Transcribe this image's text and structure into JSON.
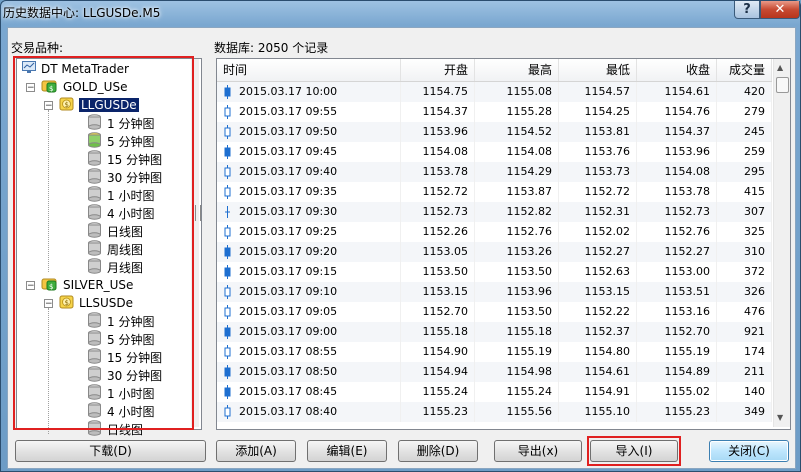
{
  "window": {
    "title": "历史数据中心: LLGUSDe.M5",
    "help_label": "?",
    "close_label": "✕"
  },
  "symbols_label": "交易品种:",
  "database_label": "数据库: 2050 个记录",
  "tree": {
    "root": "DT MetaTrader",
    "groups": [
      {
        "name": "GOLD_USe",
        "symbol": "LLGUSDe",
        "symbol_selected": true,
        "periods": [
          "1 分钟图",
          "5 分钟图",
          "15 分钟图",
          "30 分钟图",
          "1 小时图",
          "4 小时图",
          "日线图",
          "周线图",
          "月线图"
        ],
        "active_period": "5 分钟图"
      },
      {
        "name": "SILVER_USe",
        "symbol": "LLSUSDe",
        "symbol_selected": false,
        "periods": [
          "1 分钟图",
          "5 分钟图",
          "15 分钟图",
          "30 分钟图",
          "1 小时图",
          "4 小时图",
          "日线图"
        ],
        "active_period": ""
      }
    ]
  },
  "table": {
    "columns": [
      "时间",
      "开盘",
      "最高",
      "最低",
      "收盘",
      "成交量"
    ],
    "rows": [
      {
        "time": "2015.03.17 10:00",
        "open": "1154.75",
        "high": "1155.08",
        "low": "1154.57",
        "close": "1154.61",
        "vol": "420",
        "dir": "down"
      },
      {
        "time": "2015.03.17 09:55",
        "open": "1154.37",
        "high": "1155.28",
        "low": "1154.25",
        "close": "1154.76",
        "vol": "279",
        "dir": "up"
      },
      {
        "time": "2015.03.17 09:50",
        "open": "1153.96",
        "high": "1154.52",
        "low": "1153.81",
        "close": "1154.37",
        "vol": "245",
        "dir": "up"
      },
      {
        "time": "2015.03.17 09:45",
        "open": "1154.08",
        "high": "1154.08",
        "low": "1153.76",
        "close": "1153.96",
        "vol": "259",
        "dir": "down"
      },
      {
        "time": "2015.03.17 09:40",
        "open": "1153.78",
        "high": "1154.29",
        "low": "1153.73",
        "close": "1154.08",
        "vol": "295",
        "dir": "up"
      },
      {
        "time": "2015.03.17 09:35",
        "open": "1152.72",
        "high": "1153.87",
        "low": "1152.72",
        "close": "1153.78",
        "vol": "415",
        "dir": "up"
      },
      {
        "time": "2015.03.17 09:30",
        "open": "1152.73",
        "high": "1152.82",
        "low": "1152.31",
        "close": "1152.73",
        "vol": "307",
        "dir": "flat"
      },
      {
        "time": "2015.03.17 09:25",
        "open": "1152.26",
        "high": "1152.76",
        "low": "1152.02",
        "close": "1152.76",
        "vol": "325",
        "dir": "up"
      },
      {
        "time": "2015.03.17 09:20",
        "open": "1153.05",
        "high": "1153.26",
        "low": "1152.27",
        "close": "1152.27",
        "vol": "310",
        "dir": "down"
      },
      {
        "time": "2015.03.17 09:15",
        "open": "1153.50",
        "high": "1153.50",
        "low": "1152.63",
        "close": "1153.00",
        "vol": "372",
        "dir": "down"
      },
      {
        "time": "2015.03.17 09:10",
        "open": "1153.15",
        "high": "1153.96",
        "low": "1153.15",
        "close": "1153.51",
        "vol": "326",
        "dir": "up"
      },
      {
        "time": "2015.03.17 09:05",
        "open": "1152.70",
        "high": "1153.50",
        "low": "1152.22",
        "close": "1153.16",
        "vol": "476",
        "dir": "up"
      },
      {
        "time": "2015.03.17 09:00",
        "open": "1155.18",
        "high": "1155.18",
        "low": "1152.37",
        "close": "1152.70",
        "vol": "921",
        "dir": "down"
      },
      {
        "time": "2015.03.17 08:55",
        "open": "1154.90",
        "high": "1155.19",
        "low": "1154.80",
        "close": "1155.19",
        "vol": "174",
        "dir": "up"
      },
      {
        "time": "2015.03.17 08:50",
        "open": "1154.94",
        "high": "1154.98",
        "low": "1154.61",
        "close": "1154.89",
        "vol": "211",
        "dir": "down"
      },
      {
        "time": "2015.03.17 08:45",
        "open": "1155.24",
        "high": "1155.24",
        "low": "1154.91",
        "close": "1155.02",
        "vol": "140",
        "dir": "down"
      },
      {
        "time": "2015.03.17 08:40",
        "open": "1155.23",
        "high": "1155.56",
        "low": "1155.10",
        "close": "1155.23",
        "vol": "349",
        "dir": "up"
      }
    ]
  },
  "buttons": {
    "download": "下载(D)",
    "add": "添加(A)",
    "edit": "编辑(E)",
    "delete": "删除(D)",
    "export": "导出(x)",
    "import": "导入(I)",
    "close": "关闭(C)"
  },
  "colors": {
    "highlight_box": "#e02020",
    "selection": "#0a246a",
    "candle_up": "#ffffff",
    "candle_down": "#1e6fd0"
  }
}
